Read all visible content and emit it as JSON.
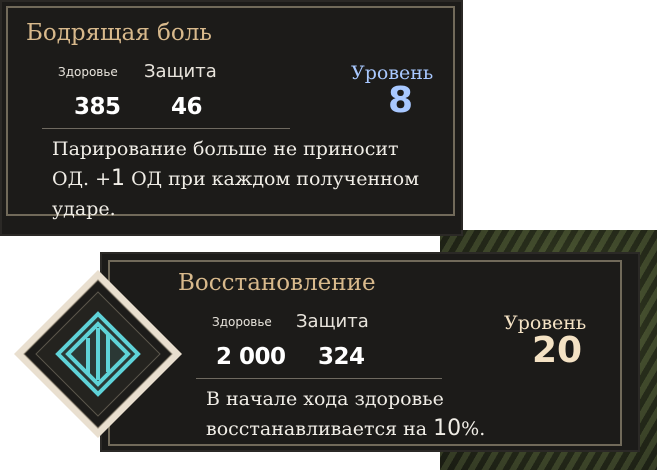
{
  "colors": {
    "title": "#d8b98c",
    "level_blue": "#a8c8ff",
    "level_cream": "#f4e2c4",
    "icon_teal": "#5fd2d8",
    "panel": "#1c1b19"
  },
  "cards": [
    {
      "title": "Бодрящая боль",
      "health_label": "Здоровье",
      "defense_label": "Защита",
      "health_value": "385",
      "defense_value": "46",
      "level_label": "Уровень",
      "level_value": "8",
      "desc_line1": "Парирование больше не приносит",
      "desc_line2_a": "ОД. +",
      "desc_line2_num": "1",
      "desc_line2_b": " ОД при каждом полученном",
      "desc_line3": "ударе."
    },
    {
      "title": "Восстановление",
      "health_label": "Здоровье",
      "defense_label": "Защита",
      "health_value": "2 000",
      "defense_value": "324",
      "level_label": "Уровень",
      "level_value": "20",
      "desc_line1": "В начале хода здоровье",
      "desc_line2_a": "восстанавливается на ",
      "desc_line2_num": "10",
      "desc_line2_b": "%.",
      "icon": "teal-diamond-sigil-icon"
    }
  ]
}
